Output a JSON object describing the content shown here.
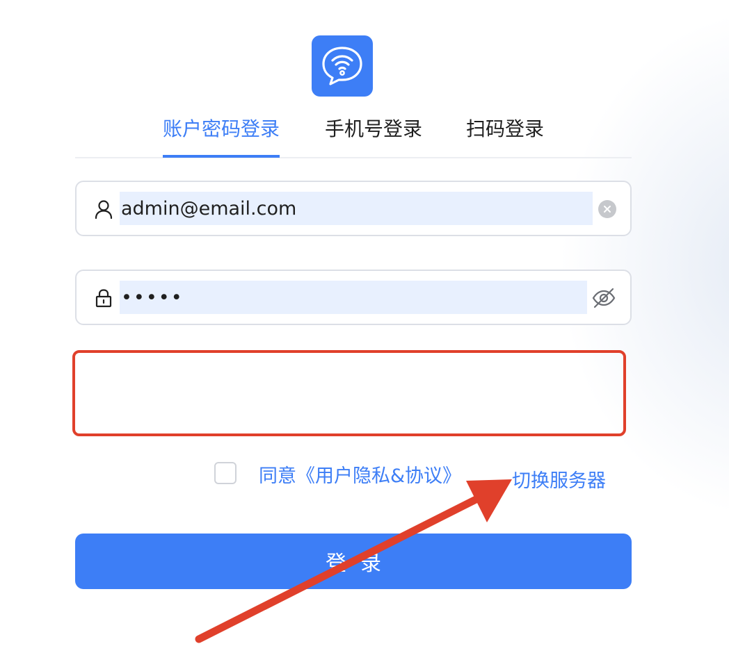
{
  "tabs": [
    {
      "label": "账户密码登录"
    },
    {
      "label": "手机号登录"
    },
    {
      "label": "扫码登录"
    }
  ],
  "username": {
    "value": "admin@email.com"
  },
  "password": {
    "value": "•••••"
  },
  "agreement": {
    "label": "同意《用户隐私&协议》",
    "checked": false
  },
  "switch_server": {
    "label": "切换服务器"
  },
  "login_button": {
    "label": "登录"
  },
  "colors": {
    "accent": "#3d7ef6",
    "annotation": "#e0402b",
    "autofill": "#e8f0fe"
  },
  "icons": [
    "chat-wifi-logo-icon",
    "user-icon",
    "clear-icon",
    "lock-icon",
    "eye-off-icon"
  ]
}
